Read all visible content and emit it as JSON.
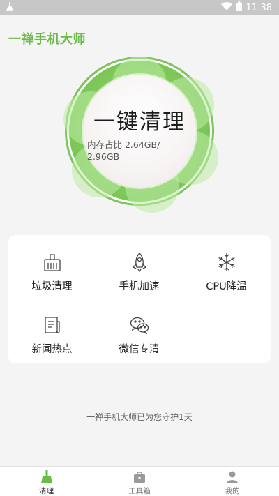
{
  "status_bar": {
    "time": "11:38"
  },
  "header": {
    "app_title": "一禅手机大师"
  },
  "cleaner": {
    "button_label": "一键清理",
    "memory_text": "内存占比 2.64GB/ 2.96GB"
  },
  "features": [
    {
      "label": "垃圾清理",
      "icon": "trash-bin-icon"
    },
    {
      "label": "手机加速",
      "icon": "rocket-icon"
    },
    {
      "label": "CPU降温",
      "icon": "snowflake-icon"
    },
    {
      "label": "新闻热点",
      "icon": "news-icon"
    },
    {
      "label": "微信专清",
      "icon": "wechat-icon"
    }
  ],
  "guard_text": "一禅手机大师已为您守护1天",
  "bottom_nav": [
    {
      "label": "清理",
      "icon": "broom-icon",
      "active": true
    },
    {
      "label": "工具箱",
      "icon": "toolbox-icon",
      "active": false
    },
    {
      "label": "我的",
      "icon": "person-icon",
      "active": false
    }
  ],
  "colors": {
    "accent": "#6cbb4a",
    "ring_green": "#7fc85a",
    "status_bar": "#c7c7c7"
  }
}
